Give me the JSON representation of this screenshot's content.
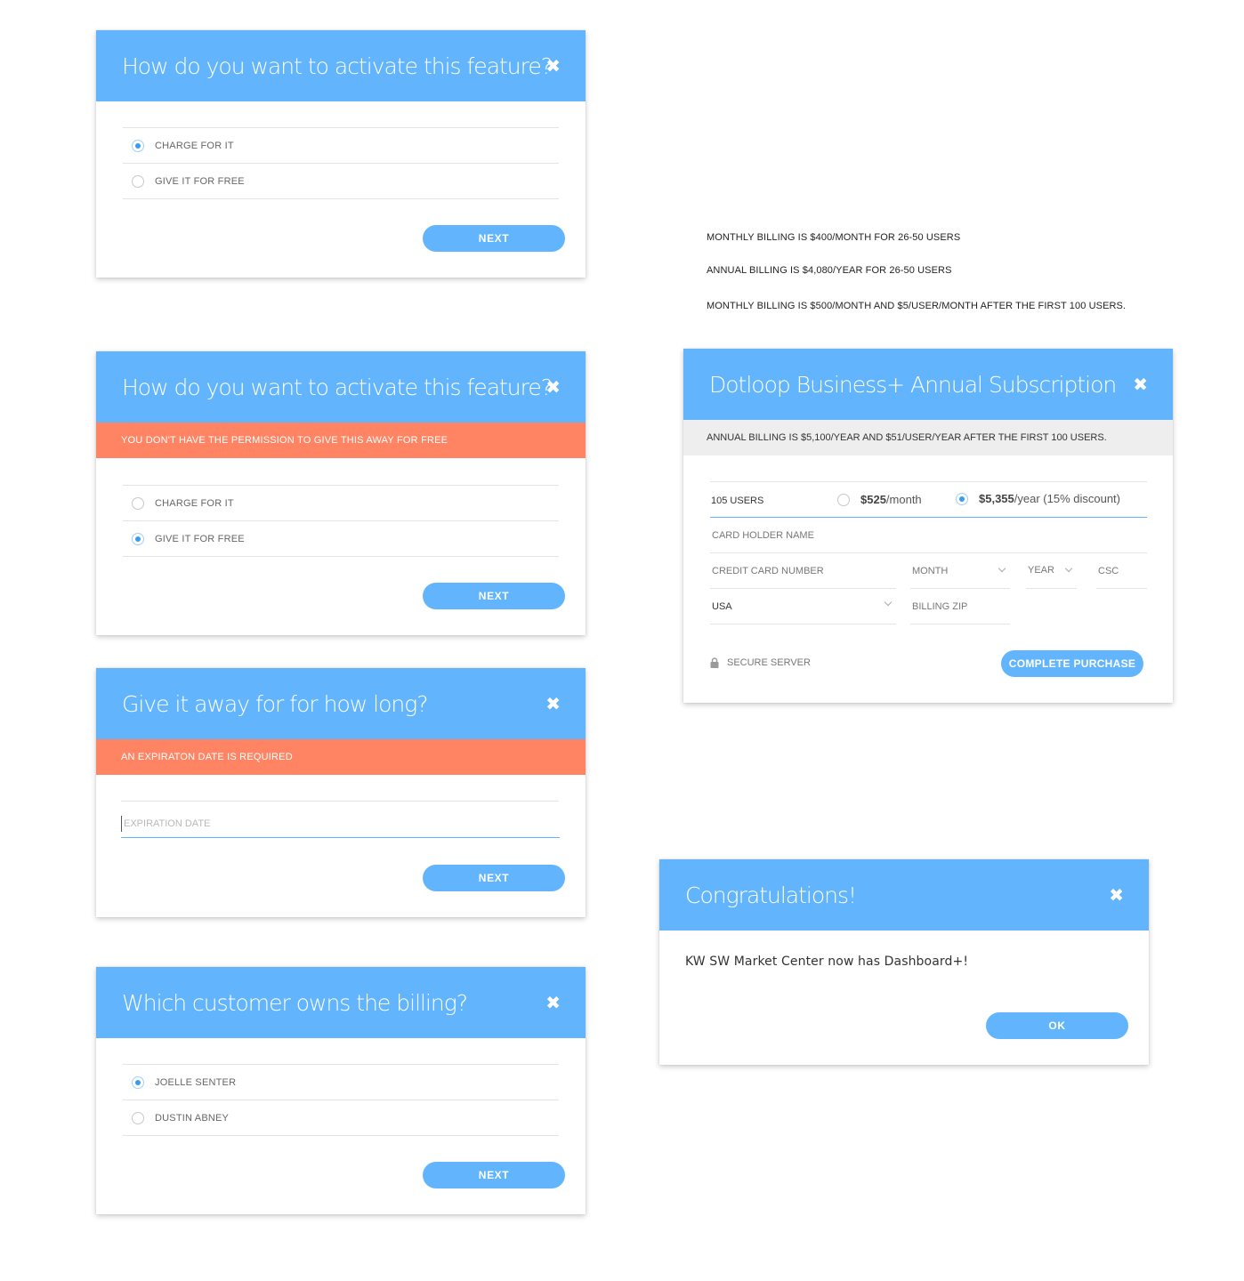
{
  "dialog1": {
    "title": "How do you want to activate this feature?",
    "close": "✖",
    "options": [
      {
        "label": "CHARGE FOR IT",
        "selected": true
      },
      {
        "label": "GIVE IT FOR FREE",
        "selected": false
      }
    ],
    "button": "NEXT"
  },
  "dialog2": {
    "title": "How do you want to activate this feature?",
    "close": "✖",
    "alert": "YOU DON'T HAVE THE PERMISSION TO GIVE THIS AWAY FOR FREE",
    "options": [
      {
        "label": "CHARGE FOR IT",
        "selected": false
      },
      {
        "label": "GIVE IT FOR FREE",
        "selected": true
      }
    ],
    "button": "NEXT"
  },
  "dialog3": {
    "title": "Give it away for for how long?",
    "close": "✖",
    "alert": "AN EXPIRATON DATE IS REQUIRED",
    "input_placeholder": "EXPIRATION DATE",
    "button": "NEXT"
  },
  "dialog4": {
    "title": "Which customer owns the billing?",
    "close": "✖",
    "options": [
      {
        "label": "JOELLE SENTER",
        "selected": true
      },
      {
        "label": "DUSTIN ABNEY",
        "selected": false
      }
    ],
    "button": "NEXT"
  },
  "notes": [
    "MONTHLY BILLING IS $400/MONTH FOR 26-50 USERS",
    "ANNUAL BILLING IS $4,080/YEAR FOR 26-50 USERS",
    "MONTHLY BILLING IS $500/MONTH AND $5/USER/MONTH AFTER THE FIRST 100 USERS."
  ],
  "subscription": {
    "title": "Dotloop Business+  Annual Subscription",
    "close": "✖",
    "info": "ANNUAL BILLING IS $5,100/YEAR AND $51/USER/YEAR AFTER THE FIRST 100 USERS.",
    "users": "105 USERS",
    "monthly_price": "$525",
    "monthly_suffix": "/month",
    "monthly_selected": false,
    "yearly_price": "$5,355",
    "yearly_suffix": "/year (15% discount)",
    "yearly_selected": true,
    "card_holder_placeholder": "CARD HOLDER NAME",
    "card_number_placeholder": "CREDIT CARD NUMBER",
    "month_label": "MONTH",
    "year_label": "YEAR",
    "csc_placeholder": "CSC",
    "country": "USA",
    "zip_placeholder": "BILLING ZIP",
    "secure_label": "SECURE SERVER",
    "button": "COMPLETE PURCHASE"
  },
  "congrats": {
    "title": "Congratulations!",
    "close": "✖",
    "message": "KW SW Market Center now has Dashboard+!",
    "button": "OK"
  },
  "colors": {
    "header_blue": "#62b5fc",
    "alert_orange": "#ff8463",
    "radio_blue": "#3a9bf0"
  }
}
